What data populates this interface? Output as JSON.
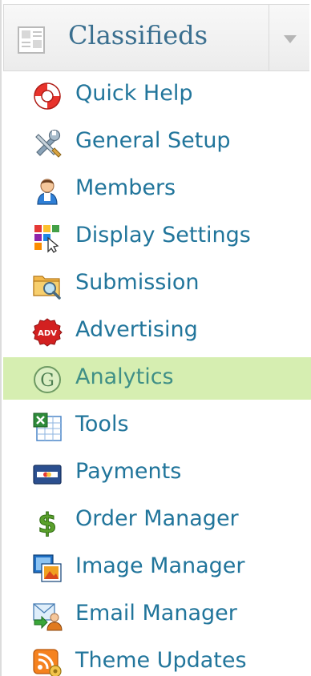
{
  "header": {
    "title": "Classifieds",
    "icon": "classifieds-document-icon",
    "toggle_icon": "triangle-down-icon"
  },
  "menu": {
    "items": [
      {
        "label": "Quick Help",
        "icon": "lifebuoy-icon",
        "active": false
      },
      {
        "label": "General Setup",
        "icon": "wrench-screwdriver-icon",
        "active": false
      },
      {
        "label": "Members",
        "icon": "user-icon",
        "active": false
      },
      {
        "label": "Display Settings",
        "icon": "color-tiles-cursor-icon",
        "active": false
      },
      {
        "label": "Submission",
        "icon": "folder-search-icon",
        "active": false
      },
      {
        "label": "Advertising",
        "icon": "adv-badge-icon",
        "active": false
      },
      {
        "label": "Analytics",
        "icon": "google-g-icon",
        "active": true
      },
      {
        "label": "Tools",
        "icon": "spreadsheet-icon",
        "active": false
      },
      {
        "label": "Payments",
        "icon": "credit-card-icon",
        "active": false
      },
      {
        "label": "Order Manager",
        "icon": "dollar-sign-icon",
        "active": false
      },
      {
        "label": "Image Manager",
        "icon": "images-icon",
        "active": false
      },
      {
        "label": "Email Manager",
        "icon": "email-user-icon",
        "active": false
      },
      {
        "label": "Theme Updates",
        "icon": "rss-feed-icon",
        "active": false
      }
    ]
  },
  "colors": {
    "link": "#21759b",
    "active_bg": "#d6eeb1",
    "active_text": "#3f8f86",
    "header_title": "#3a6f8f"
  }
}
